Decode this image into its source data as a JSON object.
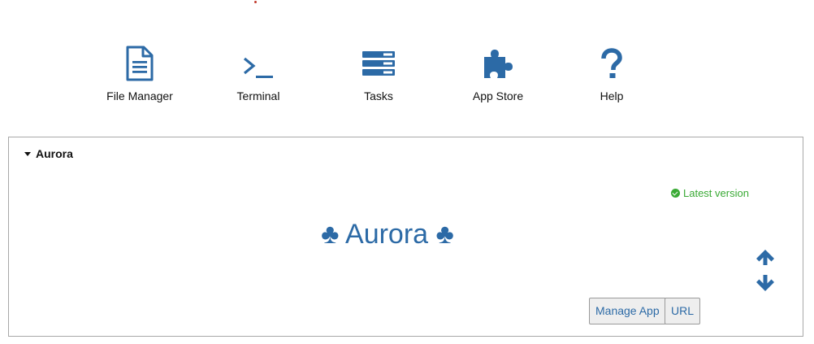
{
  "toolbar": {
    "items": [
      {
        "label": "File Manager",
        "icon": "file-icon"
      },
      {
        "label": "Terminal",
        "icon": "terminal-icon"
      },
      {
        "label": "Tasks",
        "icon": "tasks-icon"
      },
      {
        "label": "App Store",
        "icon": "puzzle-icon"
      },
      {
        "label": "Help",
        "icon": "question-icon"
      }
    ]
  },
  "panel": {
    "header": "Aurora",
    "version_status": "Latest version",
    "app_title": "♣ Aurora ♣",
    "buttons": {
      "manage": "Manage App",
      "url": "URL"
    }
  },
  "colors": {
    "accent": "#2c6aa6",
    "success": "#3aaa35",
    "border": "#a8a8a8"
  }
}
